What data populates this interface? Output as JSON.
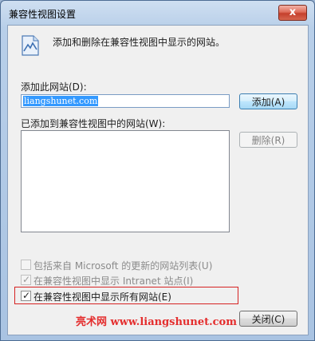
{
  "window": {
    "title": "兼容性视图设置",
    "close_glyph": "x",
    "close_icon": "close-icon"
  },
  "header": {
    "icon": "broken-page-icon",
    "text": "添加和删除在兼容性视图中显示的网站。"
  },
  "add_section": {
    "label": "添加此网站(D):",
    "input_value": "liangshunet.com",
    "add_button": "添加(A)"
  },
  "list_section": {
    "label": "已添加到兼容性视图中的网站(W):",
    "items": [],
    "remove_button": "删除(R)"
  },
  "options": [
    {
      "label": "包括来自 Microsoft 的更新的网站列表(U)",
      "checked": false,
      "enabled": false
    },
    {
      "label": "在兼容性视图中显示 Intranet 站点(I)",
      "checked": true,
      "enabled": false
    },
    {
      "label": "在兼容性视图中显示所有网站(E)",
      "checked": true,
      "enabled": true
    }
  ],
  "watermark": "亮术网 www.liangshunet.com",
  "close_button": "关闭(C)",
  "colors": {
    "highlight": "#d62222",
    "watermark": "#e42d2d",
    "selection": "#3399ff"
  }
}
